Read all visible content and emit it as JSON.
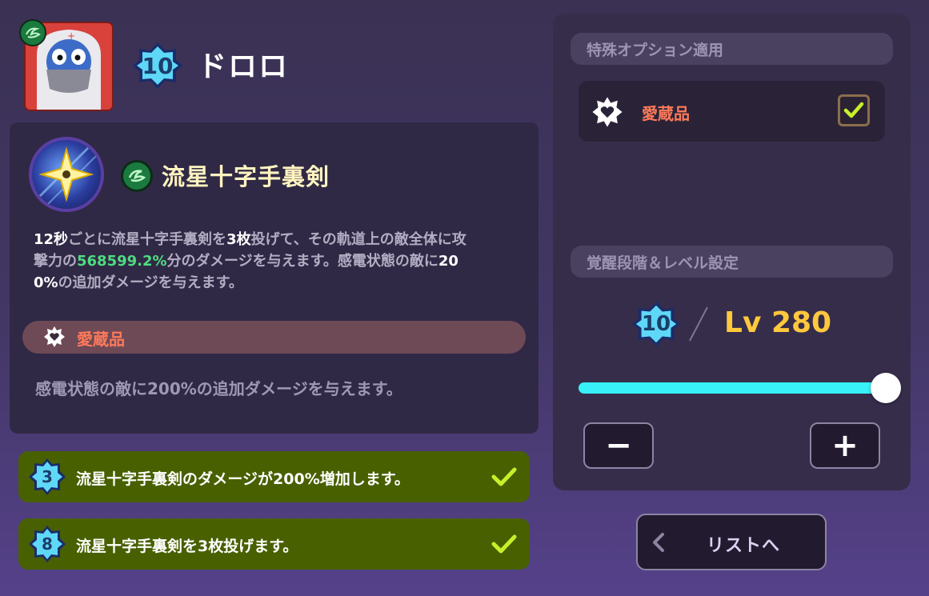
{
  "character": {
    "name": "ドロロ",
    "awakening": "10"
  },
  "skill": {
    "name": "流星十字手裏剣",
    "description": {
      "p1": "12秒",
      "p2": "ごとに流星十字手裏剣を",
      "p3": "3枚",
      "p4": "投げて、その軌道上の敵全体に攻",
      "p5": "撃力の",
      "p6": "568599.2%",
      "p7": "分のダメージを与えます。感電状態の敵に",
      "p8": "20",
      "p9": "0%",
      "p10": "の追加ダメージを与えます。"
    },
    "treasure_label": "愛蔵品",
    "treasure_description": "感電状態の敵に200%の追加ダメージを与えます。"
  },
  "upgrades": [
    {
      "level": "3",
      "text": "流星十字手裏剣のダメージが200%増加します。",
      "checked": true
    },
    {
      "level": "8",
      "text": "流星十字手裏剣を3枚投げます。",
      "checked": true
    }
  ],
  "options": {
    "header": "特殊オプション適用",
    "item_label": "愛蔵品",
    "item_checked": true
  },
  "level_settings": {
    "header": "覚醒段階＆レベル設定",
    "awakening": "10",
    "level_text": "Lv 280",
    "slider_fraction": 1.0,
    "minus_label": "−",
    "plus_label": "+"
  },
  "list_button": {
    "label": "リストへ"
  },
  "colors": {
    "green_accent": "#4ddc7f",
    "treasure_orange": "#ff7a5a",
    "level_gold": "#ffc83d",
    "slider_cyan": "#37f0f8",
    "upgrade_bg": "#486000",
    "check_lime": "#c8f02a"
  }
}
